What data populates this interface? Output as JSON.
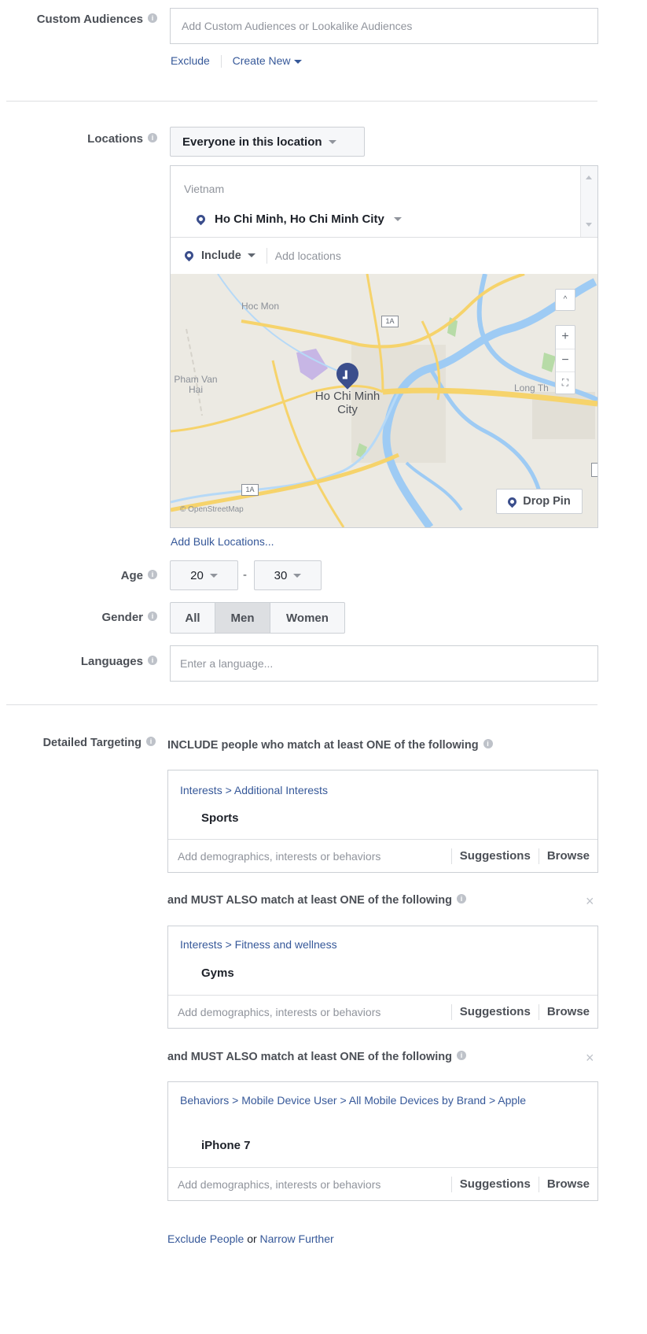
{
  "custom_audiences": {
    "label": "Custom Audiences",
    "placeholder": "Add Custom Audiences or Lookalike Audiences",
    "exclude_link": "Exclude",
    "create_new_link": "Create New"
  },
  "locations": {
    "label": "Locations",
    "dropdown_value": "Everyone in this location",
    "country": "Vietnam",
    "selected_location": "Ho Chi Minh, Ho Chi Minh City",
    "include_label": "Include",
    "add_placeholder": "Add locations",
    "map": {
      "place_labels": [
        "Hoc Mon",
        "Pham Van Hai",
        "Ho Chi Minh City",
        "Long Th"
      ],
      "road_badges": [
        "1A",
        "1A"
      ],
      "attribution": "© OpenStreetMap",
      "zoom_in": "+",
      "zoom_out": "−",
      "drop_pin_label": "Drop Pin"
    },
    "bulk_link": "Add Bulk Locations..."
  },
  "age": {
    "label": "Age",
    "min": "20",
    "max": "30",
    "separator": "-"
  },
  "gender": {
    "label": "Gender",
    "options": [
      "All",
      "Men",
      "Women"
    ],
    "selected": "Men"
  },
  "languages": {
    "label": "Languages",
    "placeholder": "Enter a language..."
  },
  "detailed_targeting": {
    "label": "Detailed Targeting",
    "include_heading": "INCLUDE people who match at least ONE of the following",
    "must_heading": "and MUST ALSO match at least ONE of the following",
    "groups": [
      {
        "path": "Interests > Additional Interests",
        "item": "Sports"
      },
      {
        "path": "Interests > Fitness and wellness",
        "item": "Gyms"
      },
      {
        "path": "Behaviors > Mobile Device User > All Mobile Devices by Brand > Apple",
        "item": "iPhone 7"
      }
    ],
    "add_placeholder": "Add demographics, interests or behaviors",
    "suggestions_label": "Suggestions",
    "browse_label": "Browse",
    "exclude_people_link": "Exclude People",
    "or_text": "or",
    "narrow_further_link": "Narrow Further"
  },
  "colors": {
    "link": "#365899",
    "pin": "#3b4e8c",
    "map_bg": "#eceae3",
    "road": "#f6d36b",
    "water": "#9ecbf4"
  }
}
